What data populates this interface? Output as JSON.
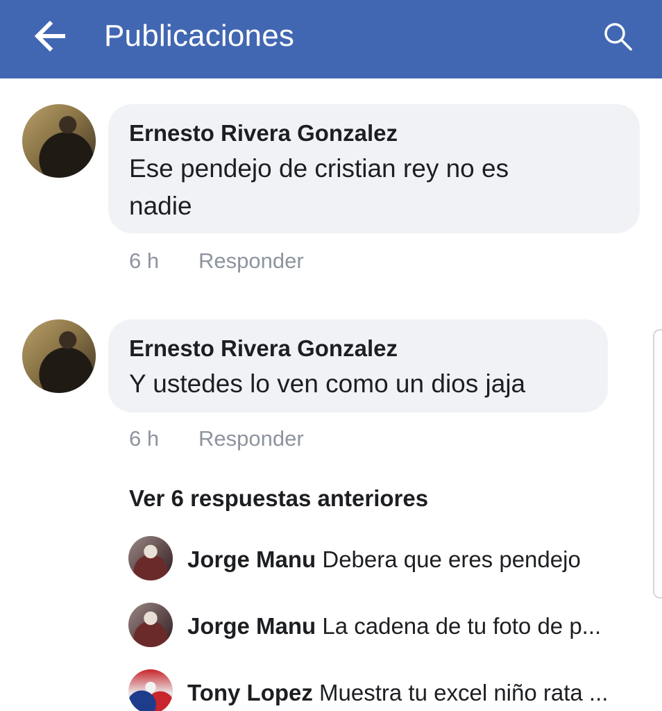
{
  "header": {
    "title": "Publicaciones",
    "back_icon": "arrow-left-icon",
    "search_icon": "search-icon",
    "bar_color": "#4267b2"
  },
  "comments": [
    {
      "author": "Ernesto Rivera Gonzalez",
      "text_line1": "Ese pendejo de cristian rey no es",
      "text_line2": "nadie",
      "time": "6 h",
      "reply_label": "Responder"
    },
    {
      "author": "Ernesto Rivera Gonzalez",
      "text_line1": "Y ustedes lo ven como un dios jaja",
      "time": "6 h",
      "reply_label": "Responder"
    }
  ],
  "view_previous": "Ver 6 respuestas anteriores",
  "replies": [
    {
      "author": "Jorge Manu",
      "text": "Debera que eres pendejo"
    },
    {
      "author": "Jorge Manu",
      "text": "La cadena de tu foto de p..."
    },
    {
      "author": "Tony Lopez",
      "text": "Muestra tu excel niño rata ..."
    }
  ]
}
